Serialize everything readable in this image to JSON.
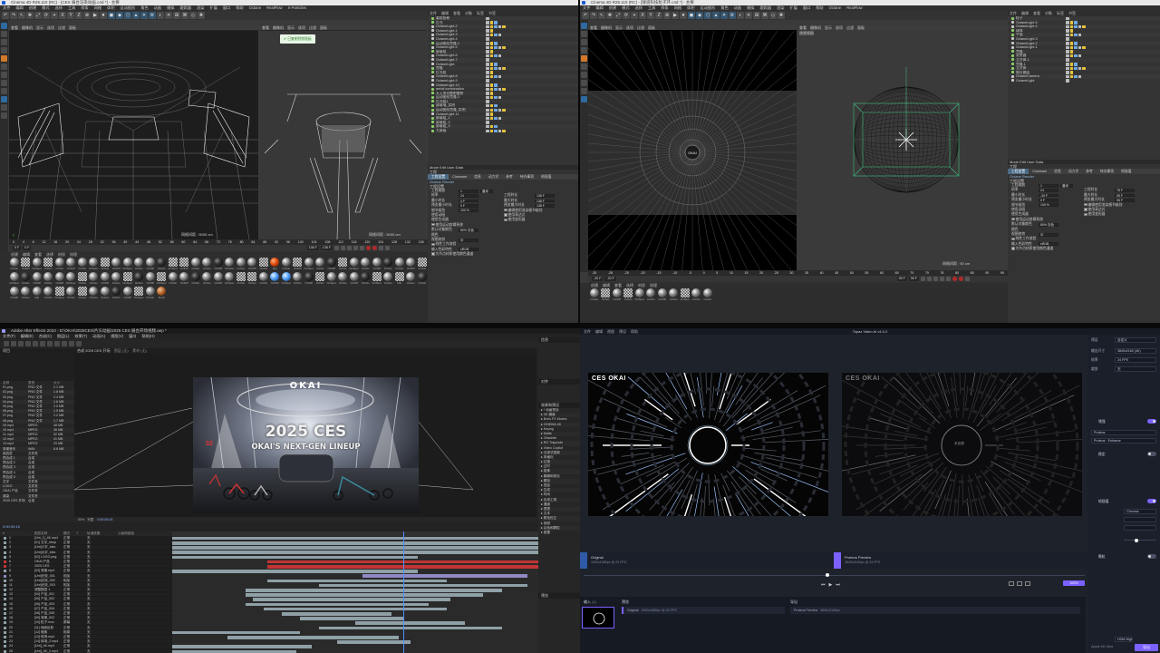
{
  "c4d_left": {
    "title": "Cinema 4D R25.110 (RC) - [CES 展台渲染动画.c4d *] - 主要",
    "menu": [
      "文件",
      "编辑",
      "创建",
      "模式",
      "选择",
      "工具",
      "样条",
      "网格",
      "体积",
      "运动图形",
      "角色",
      "动画",
      "模拟",
      "跟踪器",
      "渲染",
      "扩展",
      "窗口",
      "帮助",
      "Octane",
      "RealFlow",
      "X-Particles"
    ],
    "viewport_left_label": "透视视图",
    "viewport_left_camera": "默认摄像机 ∴",
    "viewport_left_menu": [
      "查看",
      "摄像机",
      "显示",
      "选项",
      "过滤",
      "面板"
    ],
    "viewport_left_grid": "网格间距 : 5000 cm",
    "viewport_right_label": "透视视图",
    "viewport_right_grid": "网格间距 : 5000 cm",
    "toast": "已复制到剪贴板",
    "object_tabs": [
      "文件",
      "编辑",
      "查看",
      "对象",
      "标签",
      "书签"
    ],
    "objects": [
      "柔软纸卷",
      "灯光",
      "OctaneLight.2",
      "OctaneLight.1",
      "OctaneLight.3",
      "OctaneLight.4",
      "运动图形克隆.1",
      "OctaneLight.5",
      "屏幕组",
      "OctaneLight.6",
      "OctaneLight.7",
      "OctaneLight",
      "克隆",
      "灯光组",
      "OctaneLight.8",
      "OctaneLight.9",
      "OctaneLight.10",
      "aerial kombination",
      "天上发光散射散射",
      "运动图形克隆.2",
      "灯光组1",
      "屏幕墙_实例",
      "运动图形克隆_实例",
      "OctaneLight.11",
      "屏幕组_1",
      "屏幕组_2",
      "屏幕组_3",
      "大屏幕"
    ],
    "attr_header": "Mode  Edit  User Data",
    "attr_title": "工程",
    "attr_tabs": [
      "工程设置",
      "Cineware",
      "信息",
      "动力学",
      "参考",
      "待办事项",
      "帧插值"
    ],
    "attr_subtab": "Octane Render",
    "attr_section": "工程设置",
    "attr_rows": [
      {
        "label": "工程缩放",
        "value": "1",
        "unit": "厘米"
      },
      {
        "label": "帧率",
        "value": "24",
        "label2": "工程时长",
        "value2": "138 F"
      },
      {
        "label": "最小时长",
        "value": "0 F",
        "label2": "最大时长",
        "value2": "138 F"
      },
      {
        "label": "预览最小时长",
        "value": "0 F",
        "label2": "预览最大时长",
        "value2": "138 F"
      },
      {
        "label": "细节级别",
        "value": "100 %",
        "label2": "编辑使用渲染细节级别"
      },
      {
        "label": "使用动画",
        "label2": "使用表达式"
      },
      {
        "label": "使用生成器",
        "label2": "使用变形器"
      },
      {
        "label": "使用运动剪辑系统"
      },
      {
        "label": "默认对象颜色",
        "value": "80% 灰色"
      },
      {
        "label": "颜色"
      },
      {
        "label": "视图修剪",
        "value": "中"
      },
      {
        "label": "线性工作流程"
      },
      {
        "label": "输入色彩特性",
        "value": "sRGB"
      },
      {
        "label": "为节点材质使用颜色通道"
      }
    ],
    "timeline_ticks": [
      "0",
      "2",
      "4",
      "6",
      "8",
      "10",
      "12",
      "14",
      "16",
      "18",
      "20",
      "22",
      "24",
      "26",
      "28",
      "30",
      "32",
      "34",
      "36",
      "38",
      "40",
      "42",
      "44",
      "46",
      "48",
      "50",
      "52",
      "54",
      "56",
      "58",
      "60",
      "62",
      "64",
      "66",
      "68",
      "70",
      "72",
      "74",
      "76",
      "78",
      "80",
      "82",
      "84",
      "86",
      "88",
      "90",
      "92",
      "94",
      "96",
      "98",
      "100",
      "102",
      "104",
      "106",
      "108",
      "110",
      "112",
      "114",
      "116",
      "118",
      "120",
      "122",
      "124",
      "126",
      "128",
      "130",
      "132",
      "134",
      "136",
      "138"
    ],
    "frame_start": "0 F",
    "frame_current": "0 F",
    "frame_end": "138 F",
    "frame_end2": "138 F",
    "current_frame_label": "138 F",
    "mat_tabs": [
      "创建",
      "编辑",
      "查看",
      "选择",
      "材质",
      "纹理"
    ],
    "materials": [
      "OctGlo",
      "OctDiff",
      "OctSpec",
      "Octane",
      "OctGlo",
      "OctDiff",
      "OctGlo",
      "OctSpec",
      "OctGlo",
      "OctDiff",
      "OctSpec",
      "OctGlo",
      "OctDiff",
      "OctGlo",
      "OctSpec",
      "OctDiff",
      "OctGlo",
      "OctGlo",
      "OctDiff",
      "OctSpec",
      "OctGlo",
      "OctDiff",
      "OctGlo",
      "Mat",
      "OctGlo",
      "OctDiff",
      "OctSpec",
      "OctGlo",
      "OctDiff",
      "OctGlo",
      "OctSpec",
      "OctGlo",
      "OctDiff",
      "OctGlo",
      "OctGlo",
      "OctDiff",
      "OctGlo",
      "OctSpec",
      "OctGlo",
      "OctDiff",
      "OctGlo",
      "OctDiff",
      "OctSpec",
      "OctGlo",
      "OctGlo",
      "OctDiff",
      "OctGlo",
      "OctSpec",
      "OctGlo",
      "OctDiff",
      "OctSpec",
      "OctGlo",
      "OctDiff",
      "OctGlo",
      "OctGlo",
      "OctDiff",
      "OctSpec",
      "OctGlo",
      "Octane",
      "OctGlo",
      "OctDiff",
      "OctSpec",
      "OctGlo",
      "OctDiff",
      "OctGlo",
      "OctSpec",
      "OctGlo",
      "OctDiff",
      "OctGlo",
      "OctSpec",
      "OctGlo",
      "Mat",
      "Octane",
      "OctGlo",
      "OctDiff",
      "Octane",
      "Mat",
      "OctGlo",
      "OctSpec",
      "OctGlo",
      "Octane",
      "Octane",
      "Octane",
      "OctGlo",
      "OctDiff",
      "OctSpec",
      "OctGlo",
      "Metal"
    ]
  },
  "c4d_right": {
    "title": "Cinema 4D R25.110 (RC) - [隧道科技粒子环.c4d *] - 主要",
    "menu": [
      "文件",
      "编辑",
      "创建",
      "模式",
      "选择",
      "工具",
      "样条",
      "网格",
      "体积",
      "运动图形",
      "角色",
      "动画",
      "模拟",
      "跟踪器",
      "渲染",
      "扩展",
      "窗口",
      "帮助",
      "Octane",
      "RealFlow"
    ],
    "viewport_left_menu": [
      "查看",
      "摄像机",
      "显示",
      "选项",
      "过滤",
      "面板"
    ],
    "viewport_right_label": "透视视图",
    "viewport_right_grid": "网格间距 : 50 cm",
    "okai_logo": "OKAI",
    "objects": [
      "粒子",
      "OctaneLight.5",
      "OctaneLight.4",
      "球体",
      "平面",
      "OctaneLight.3",
      "OctaneLight.2",
      "OctaneLight.1",
      "克隆",
      "发射器",
      "立方体.1",
      "克隆.1",
      "立方体",
      "细分曲面",
      "OctaneCamera",
      "OctaneLight"
    ],
    "attr_header": "Mode  Edit  User Data",
    "attr_title": "工程",
    "attr_tabs": [
      "工程设置",
      "Cineware",
      "信息",
      "动力学",
      "参考",
      "待办事项",
      "帧插值"
    ],
    "attr_subtab": "Octane Render",
    "attr_section": "工程设置",
    "attr_rows": [
      {
        "label": "工程缩放",
        "value": "1",
        "unit": "厘米"
      },
      {
        "label": "帧率",
        "value": "24",
        "label2": "工程时长",
        "value2": "78 F"
      },
      {
        "label": "最小时长",
        "value": "-30 F",
        "label2": "最大时长",
        "value2": "95 F"
      },
      {
        "label": "预览最小时长",
        "value": "0 F",
        "label2": "预览最大时长",
        "value2": "95 F"
      },
      {
        "label": "细节级别",
        "value": "100 %",
        "label2": "编辑使用渲染细节级别"
      },
      {
        "label": "使用动画",
        "label2": "使用表达式"
      },
      {
        "label": "使用生成器",
        "label2": "使用变形器"
      },
      {
        "label": "使用运动剪辑系统"
      },
      {
        "label": "默认对象颜色",
        "value": "80% 灰色"
      },
      {
        "label": "颜色"
      },
      {
        "label": "视图修剪",
        "value": "中"
      },
      {
        "label": "线性工作流程"
      },
      {
        "label": "输入色彩特性",
        "value": "sRGB"
      },
      {
        "label": "为节点材质使用颜色通道"
      }
    ],
    "timeline_ticks": [
      "-30",
      "-28",
      "-25",
      "-20",
      "-15",
      "-10",
      "-5",
      "0",
      "5",
      "10",
      "15",
      "20",
      "25",
      "30",
      "35",
      "40",
      "45",
      "50",
      "55",
      "60",
      "65",
      "70",
      "75",
      "78",
      "80",
      "85",
      "90",
      "95"
    ],
    "frame_start": "-30 F",
    "frame_current": "-30 F",
    "frame_end": "95 F",
    "frame_end2": "95 F",
    "current_frame_label": "78 F",
    "materials": [
      "OctGlo",
      "OctGlo",
      "OctDiff",
      "OctGlo",
      "OctSpec",
      "OctGlo",
      "OctDiff",
      "OctGlo",
      "OctSpec",
      "OctGlo",
      "OctGlo"
    ]
  },
  "ae": {
    "title": "Adobe After Effects 2023 - D:\\OKAI\\2025CES\\片头动画\\2025 CES 展台开场视频.aep *",
    "menu": [
      "文件(F)",
      "编辑(E)",
      "合成(C)",
      "图层(L)",
      "效果(T)",
      "动画(A)",
      "视图(V)",
      "窗口",
      "帮助(H)"
    ],
    "comp_tab": "合成  2025 CES 开场",
    "comp_tab2": "图层  (无)",
    "footage_label": "素材 (无)",
    "project_head": "项目",
    "project_cols": [
      "名称",
      "类型",
      "大小"
    ],
    "project_items": [
      [
        "01.png",
        "PNG 文件",
        "2.1 MB"
      ],
      [
        "02.png",
        "PNG 文件",
        "1.8 MB"
      ],
      [
        "03.png",
        "PNG 文件",
        "2.4 MB"
      ],
      [
        "04.png",
        "PNG 文件",
        "1.6 MB"
      ],
      [
        "05.png",
        "PNG 文件",
        "2.0 MB"
      ],
      [
        "06.png",
        "PNG 文件",
        "1.9 MB"
      ],
      [
        "07.png",
        "PNG 文件",
        "2.2 MB"
      ],
      [
        "08.png",
        "PNG 文件",
        "1.7 MB"
      ],
      [
        "09.mp4",
        "MPEG",
        "48 MB"
      ],
      [
        "10.mp4",
        "MPEG",
        "36 MB"
      ],
      [
        "11.mp4",
        "MPEG",
        "52 MB"
      ],
      [
        "12.mp4",
        "MPEG",
        "41 MB"
      ],
      [
        "13.mp4",
        "MPEG",
        "29 MB"
      ],
      [
        "背景音乐",
        "WAV",
        "8.6 MB"
      ],
      [
        "固态层",
        "文件夹",
        ""
      ],
      [
        "预合成 1",
        "合成",
        ""
      ],
      [
        "预合成 2",
        "合成",
        ""
      ],
      [
        "预合成 3",
        "合成",
        ""
      ],
      [
        "预合成 4",
        "合成",
        ""
      ],
      [
        "预合成 5",
        "合成",
        ""
      ],
      [
        "文字",
        "文件夹",
        ""
      ],
      [
        "LOGO",
        "文件夹",
        ""
      ],
      [
        "OKAI 产品",
        "文件夹",
        ""
      ],
      [
        "渲染",
        "文件夹",
        ""
      ],
      [
        "2025 CES 开场",
        "合成",
        ""
      ]
    ],
    "render_title": "2025 CES",
    "render_subtitle": "OKAI'S NEXT-GEN LINEUP",
    "render_logo": "OKAI",
    "render_side": "02",
    "zoom": "50%",
    "quality": "完整",
    "timecode": "0:00:09:15",
    "layer_cols": [
      "#",
      "图层名称",
      "模式",
      "T",
      "轨道遮罩",
      "父级和链接"
    ],
    "layers": [
      {
        "name": "[Unt_1]_4K.mp4",
        "mode": "正常",
        "parent": "无",
        "color": "#8fa0a6"
      },
      {
        "name": "[01] 文字_nbsp",
        "mode": "正常",
        "parent": "无",
        "color": "#8fa0a6"
      },
      {
        "name": "[Unt]小字_stko",
        "mode": "正常",
        "parent": "无",
        "color": "#8fa0a6"
      },
      {
        "name": "[Unt]大字_stko",
        "mode": "正常",
        "parent": "无",
        "color": "#8fa0a6"
      },
      {
        "name": "[02] LOGO.png",
        "mode": "正常",
        "parent": "无",
        "color": "#8fa0a6"
      },
      {
        "name": "OKAI 产品",
        "mode": "正常",
        "parent": "无",
        "color": "#c23434"
      },
      {
        "name": "2025 CES",
        "mode": "正常",
        "parent": "无",
        "color": "#c23434"
      },
      {
        "name": "[03] 背景.mp4",
        "mode": "正常",
        "parent": "无",
        "color": "#8fa0a6"
      },
      {
        "name": "[Unt]光效_001",
        "mode": "相加",
        "parent": "无",
        "color": "#8f89c4"
      },
      {
        "name": "[Unt]光效_002",
        "mode": "相加",
        "parent": "无",
        "color": "#8fa0a6"
      },
      {
        "name": "[Unt]光效_003",
        "mode": "相加",
        "parent": "无",
        "color": "#8fa0a6"
      },
      {
        "name": "调整图层 1",
        "mode": "正常",
        "parent": "无",
        "color": "#8fa0a6"
      },
      {
        "name": "[04] 产品_001",
        "mode": "正常",
        "parent": "无",
        "color": "#8fa0a6"
      },
      {
        "name": "[05] 产品_002",
        "mode": "正常",
        "parent": "无",
        "color": "#8fa0a6"
      },
      {
        "name": "[06] 产品_003",
        "mode": "正常",
        "parent": "无",
        "color": "#8fa0a6"
      },
      {
        "name": "[07] 产品_004",
        "mode": "正常",
        "parent": "无",
        "color": "#8fa0a6"
      },
      {
        "name": "[08] 产品_005",
        "mode": "正常",
        "parent": "无",
        "color": "#8fa0a6"
      },
      {
        "name": "[09] 背景_002",
        "mode": "正常",
        "parent": "无",
        "color": "#8fa0a6"
      },
      {
        "name": "[10] 粒子.mov",
        "mode": "屏幕",
        "parent": "无",
        "color": "#8fa0a6"
      },
      {
        "name": "[11] 地面反射",
        "mode": "正常",
        "parent": "无",
        "color": "#8fa0a6"
      },
      {
        "name": "[12] 暗角",
        "mode": "相乘",
        "parent": "无",
        "color": "#8fa0a6"
      },
      {
        "name": "[13] 转场.mp4",
        "mode": "正常",
        "parent": "无",
        "color": "#8fa0a6"
      },
      {
        "name": "[14] 转场_2.mp4",
        "mode": "正常",
        "parent": "无",
        "color": "#8fa0a6"
      },
      {
        "name": "[Unt]_4K.mp4",
        "mode": "正常",
        "parent": "无",
        "color": "#8fa0a6"
      },
      {
        "name": "[Unt]_4K_2.mp4",
        "mode": "正常",
        "parent": "无",
        "color": "#8fa0a6"
      }
    ],
    "effects_head": "效果和预设",
    "effects": [
      "* 动画预设",
      "3D 通道",
      "Boris FX Mocha",
      "CINEMA 4D",
      "Keying",
      "Matte",
      "Obsolete",
      "RG Trapcode",
      "Video Copilot",
      "沉浸式视频",
      "风格化",
      "过渡",
      "过时",
      "抠像",
      "模糊和锐化",
      "模拟",
      "扭曲",
      "生成",
      "时间",
      "实用工具",
      "通道",
      "透视",
      "文本",
      "颜色校正",
      "音频",
      "杂色和颗粒",
      "遮罩"
    ],
    "align_head": "对齐",
    "info_head": "信息"
  },
  "topaz": {
    "title": "Topaz Video AI  v4.0.2",
    "menu": [
      "文件",
      "编辑",
      "视图",
      "预设",
      "帮助"
    ],
    "left_logo": "CES OKAI",
    "right_logo": "CES OKAI",
    "right_caption": "未处理",
    "left_file": "Original",
    "left_meta": "1920x1080px @ 24 FPS",
    "right_file": "Proteus  Preview",
    "right_meta": "3840x2160px @ 24 FPS",
    "queue_label": "输入",
    "queue_count": "(1)",
    "preview_label": "预览",
    "export_label": "导出",
    "queue_item": "Original",
    "queue_meta": "1920x1080px @ 24 FPS",
    "preview_item": "Proteus  Preview",
    "preview_meta": "3840x2160px",
    "preset_label": "预设",
    "preset_value": "自定义",
    "settings": [
      {
        "label": "输出尺寸",
        "value": "3840x2160 (4K)"
      },
      {
        "label": "帧率",
        "value": "24 FPS"
      },
      {
        "label": "裁剪",
        "value": "无"
      }
    ],
    "enhance_label": "增强",
    "enhance_model": "Proteus",
    "enhance_sub": "Proteus · Enhance",
    "stabilize_label": "稳定",
    "interp_label": "帧插值",
    "interp_model": "Chronos",
    "grain_label": "颗粒",
    "export_btn": "导出",
    "format_label": "H264 High",
    "zoom_value": "100%",
    "footer": "Apple M1 Max"
  }
}
